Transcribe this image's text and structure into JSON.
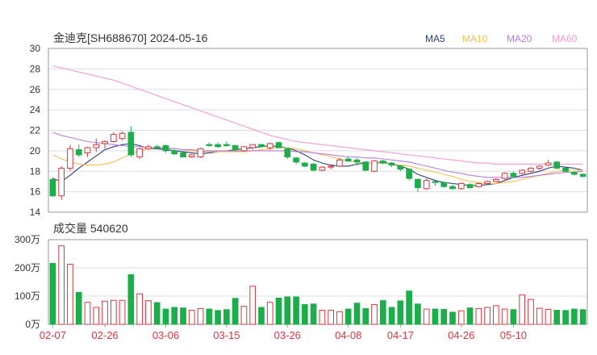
{
  "chart_data": [
    {
      "type": "candlestick",
      "title": "金迪克[SH688670] 2024-05-16",
      "legend": [
        {
          "name": "MA5",
          "color": "#2b3d78"
        },
        {
          "name": "MA10",
          "color": "#f2c14e"
        },
        {
          "name": "MA20",
          "color": "#b57ee0"
        },
        {
          "name": "MA60",
          "color": "#f39ad0"
        }
      ],
      "ylim": [
        14,
        30
      ],
      "yticks": [
        "14",
        "16",
        "18",
        "20",
        "22",
        "24",
        "26",
        "28",
        "30"
      ],
      "x_tick_labels": [
        {
          "label": "02-07",
          "index": 0
        },
        {
          "label": "02-26",
          "index": 6
        },
        {
          "label": "03-06",
          "index": 13
        },
        {
          "label": "03-15",
          "index": 20
        },
        {
          "label": "03-26",
          "index": 27
        },
        {
          "label": "04-08",
          "index": 34
        },
        {
          "label": "04-17",
          "index": 40
        },
        {
          "label": "04-26",
          "index": 47
        },
        {
          "label": "05-10",
          "index": 53
        }
      ],
      "ohlc": [
        [
          17.2,
          17.4,
          15.5,
          15.6
        ],
        [
          15.6,
          18.5,
          15.2,
          18.3
        ],
        [
          18.3,
          20.6,
          18.0,
          20.2
        ],
        [
          20.1,
          20.6,
          19.4,
          19.6
        ],
        [
          19.8,
          20.4,
          19.4,
          20.3
        ],
        [
          20.3,
          21.2,
          19.9,
          20.6
        ],
        [
          20.7,
          21.0,
          20.2,
          20.9
        ],
        [
          20.9,
          21.8,
          20.8,
          21.6
        ],
        [
          21.2,
          21.9,
          21.0,
          21.7
        ],
        [
          21.8,
          22.4,
          19.4,
          19.6
        ],
        [
          19.4,
          20.3,
          19.2,
          20.2
        ],
        [
          20.2,
          20.6,
          20.1,
          20.4
        ],
        [
          20.4,
          20.6,
          20.2,
          20.3
        ],
        [
          20.5,
          20.6,
          19.8,
          20.0
        ],
        [
          20.0,
          20.2,
          19.6,
          19.7
        ],
        [
          19.8,
          19.9,
          19.4,
          19.4
        ],
        [
          19.4,
          19.7,
          19.3,
          19.6
        ],
        [
          19.4,
          20.3,
          19.3,
          20.2
        ],
        [
          20.6,
          20.8,
          20.4,
          20.5
        ],
        [
          20.6,
          20.8,
          20.3,
          20.4
        ],
        [
          20.6,
          20.9,
          20.4,
          20.5
        ],
        [
          20.5,
          20.6,
          19.9,
          20.1
        ],
        [
          20.0,
          20.4,
          19.9,
          20.4
        ],
        [
          20.3,
          20.6,
          20.1,
          20.6
        ],
        [
          20.6,
          20.7,
          20.3,
          20.4
        ],
        [
          20.3,
          20.8,
          20.1,
          20.7
        ],
        [
          20.8,
          20.9,
          20.3,
          20.3
        ],
        [
          20.2,
          20.3,
          19.2,
          19.4
        ],
        [
          19.3,
          19.4,
          18.7,
          18.9
        ],
        [
          18.8,
          18.9,
          18.4,
          18.5
        ],
        [
          18.7,
          18.8,
          18.0,
          18.1
        ],
        [
          18.1,
          18.5,
          18.0,
          18.4
        ],
        [
          18.4,
          18.6,
          18.2,
          18.5
        ],
        [
          18.5,
          19.3,
          18.4,
          19.1
        ],
        [
          19.2,
          19.4,
          18.9,
          19.0
        ],
        [
          19.1,
          19.3,
          18.6,
          18.9
        ],
        [
          18.9,
          19.0,
          18.0,
          18.1
        ],
        [
          18.0,
          19.1,
          17.9,
          19.0
        ],
        [
          19.0,
          19.1,
          18.7,
          18.8
        ],
        [
          18.8,
          18.9,
          18.4,
          18.6
        ],
        [
          18.5,
          18.6,
          18.0,
          18.2
        ],
        [
          18.2,
          18.3,
          17.1,
          17.3
        ],
        [
          17.2,
          17.3,
          16.0,
          16.4
        ],
        [
          16.3,
          17.3,
          16.2,
          17.1
        ],
        [
          17.0,
          17.2,
          16.6,
          16.9
        ],
        [
          16.9,
          17.0,
          16.4,
          16.5
        ],
        [
          16.5,
          16.7,
          16.2,
          16.3
        ],
        [
          16.3,
          16.9,
          16.2,
          16.8
        ],
        [
          16.7,
          16.8,
          16.3,
          16.4
        ],
        [
          16.5,
          16.9,
          16.4,
          16.8
        ],
        [
          16.8,
          17.1,
          16.7,
          17.0
        ],
        [
          17.0,
          17.3,
          16.9,
          17.2
        ],
        [
          17.3,
          17.9,
          17.2,
          17.8
        ],
        [
          17.8,
          18.0,
          17.3,
          17.5
        ],
        [
          17.8,
          18.2,
          17.7,
          18.1
        ],
        [
          18.0,
          18.4,
          17.9,
          18.3
        ],
        [
          18.3,
          18.6,
          18.1,
          18.5
        ],
        [
          18.6,
          19.1,
          18.5,
          18.8
        ],
        [
          18.9,
          19.0,
          18.2,
          18.3
        ],
        [
          18.3,
          18.4,
          17.9,
          18.0
        ],
        [
          17.9,
          18.0,
          17.6,
          17.7
        ],
        [
          17.7,
          17.8,
          17.4,
          17.5
        ]
      ],
      "ma": {
        "MA5": [
          17.3,
          17.0,
          17.6,
          18.3,
          18.9,
          19.5,
          20.1,
          20.4,
          20.6,
          20.7,
          20.5,
          20.2,
          20.2,
          20.1,
          20.0,
          19.9,
          19.8,
          19.7,
          19.8,
          19.9,
          20.0,
          20.1,
          20.2,
          20.3,
          20.4,
          20.5,
          20.4,
          20.3,
          20.0,
          19.6,
          19.1,
          18.8,
          18.6,
          18.5,
          18.5,
          18.7,
          18.8,
          18.8,
          18.9,
          18.7,
          18.5,
          18.2,
          17.7,
          17.4,
          17.1,
          16.9,
          16.8,
          16.7,
          16.6,
          16.6,
          16.7,
          16.8,
          17.1,
          17.4,
          17.6,
          17.8,
          18.0,
          18.3,
          18.5,
          18.4,
          18.3,
          18.1
        ],
        "MA10": [
          19.6,
          19.2,
          18.9,
          18.7,
          18.6,
          18.6,
          18.7,
          18.9,
          19.3,
          19.7,
          20.0,
          20.2,
          20.3,
          20.3,
          20.2,
          20.1,
          20.0,
          19.9,
          19.9,
          19.9,
          19.9,
          19.9,
          19.9,
          20.0,
          20.1,
          20.2,
          20.3,
          20.3,
          20.2,
          20.0,
          19.8,
          19.6,
          19.4,
          19.2,
          19.0,
          18.9,
          18.8,
          18.8,
          18.8,
          18.7,
          18.6,
          18.5,
          18.3,
          18.1,
          17.9,
          17.7,
          17.5,
          17.2,
          17.0,
          16.9,
          16.8,
          16.8,
          16.9,
          17.0,
          17.2,
          17.4,
          17.6,
          17.8,
          18.0,
          18.1,
          18.1,
          18.1
        ],
        "MA20": [
          21.8,
          21.5,
          21.3,
          21.1,
          20.9,
          20.8,
          20.7,
          20.6,
          20.5,
          20.4,
          20.4,
          20.3,
          20.3,
          20.2,
          20.2,
          20.1,
          20.1,
          20.0,
          20.0,
          20.0,
          20.0,
          20.0,
          20.0,
          20.0,
          20.0,
          20.0,
          20.0,
          20.0,
          19.9,
          19.9,
          19.8,
          19.7,
          19.6,
          19.5,
          19.4,
          19.4,
          19.3,
          19.3,
          19.2,
          19.1,
          19.0,
          18.9,
          18.7,
          18.5,
          18.3,
          18.1,
          17.9,
          17.8,
          17.6,
          17.5,
          17.4,
          17.4,
          17.4,
          17.4,
          17.4,
          17.5,
          17.6,
          17.7,
          17.8,
          17.9,
          17.9,
          18.0
        ],
        "MA60": [
          28.3,
          28.1,
          27.9,
          27.7,
          27.5,
          27.3,
          27.1,
          26.9,
          26.6,
          26.3,
          26.0,
          25.7,
          25.4,
          25.1,
          24.8,
          24.5,
          24.2,
          23.9,
          23.6,
          23.3,
          23.0,
          22.7,
          22.4,
          22.1,
          21.8,
          21.5,
          21.3,
          21.1,
          20.9,
          20.8,
          20.7,
          20.6,
          20.5,
          20.4,
          20.3,
          20.2,
          20.1,
          20.0,
          19.9,
          19.8,
          19.7,
          19.6,
          19.5,
          19.4,
          19.3,
          19.2,
          19.1,
          19.0,
          18.9,
          18.8,
          18.8,
          18.7,
          18.7,
          18.7,
          18.7,
          18.7,
          18.7,
          18.7,
          18.7,
          18.7,
          18.7,
          18.7
        ]
      }
    },
    {
      "type": "bar",
      "title": "成交量 540620",
      "ylim": [
        0,
        300
      ],
      "yticks": [
        "0万",
        "100万",
        "200万",
        "300万"
      ],
      "volume": [
        216,
        278,
        213,
        113,
        78,
        60,
        82,
        85,
        85,
        176,
        108,
        84,
        77,
        54,
        60,
        58,
        50,
        56,
        54,
        49,
        52,
        92,
        64,
        135,
        60,
        78,
        93,
        97,
        97,
        70,
        72,
        50,
        50,
        45,
        54,
        75,
        56,
        70,
        84,
        60,
        83,
        118,
        72,
        54,
        54,
        53,
        43,
        48,
        58,
        56,
        60,
        66,
        54,
        52,
        104,
        88,
        57,
        53,
        50,
        49,
        54,
        52
      ]
    }
  ]
}
